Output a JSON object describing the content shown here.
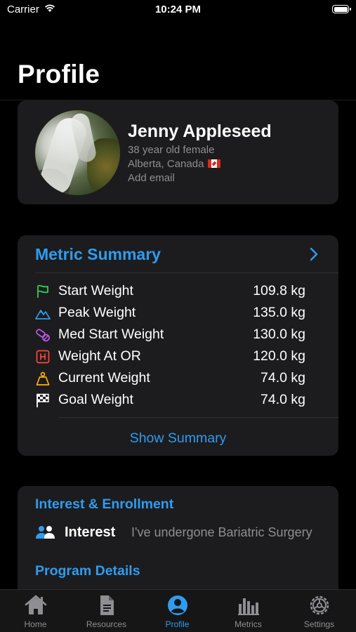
{
  "status": {
    "carrier": "Carrier",
    "time": "10:24 PM"
  },
  "page": {
    "title": "Profile"
  },
  "profile": {
    "name": "Jenny Appleseed",
    "age_gender": "38 year old female",
    "location": "Alberta, Canada",
    "email_placeholder": "Add email"
  },
  "metric_summary": {
    "title": "Metric Summary",
    "rows": [
      {
        "label": "Start Weight",
        "value": "109.8 kg",
        "icon": "flag-icon",
        "color": "#30d158"
      },
      {
        "label": "Peak Weight",
        "value": "135.0 kg",
        "icon": "mountain-icon",
        "color": "#2f9cf0"
      },
      {
        "label": "Med Start Weight",
        "value": "130.0 kg",
        "icon": "pills-icon",
        "color": "#bf5af2"
      },
      {
        "label": "Weight At OR",
        "value": "120.0 kg",
        "icon": "hospital-icon",
        "color": "#ff453a"
      },
      {
        "label": "Current Weight",
        "value": "74.0 kg",
        "icon": "scale-icon",
        "color": "#ffb300"
      },
      {
        "label": "Goal Weight",
        "value": "74.0 kg",
        "icon": "checkered-flag-icon",
        "color": "#ffffff"
      }
    ],
    "show_summary": "Show Summary"
  },
  "interest": {
    "title": "Interest & Enrollment",
    "label": "Interest",
    "value": "I've undergone Bariatric Surgery",
    "program_details": "Program Details"
  },
  "tabs": [
    {
      "label": "Home",
      "icon": "home-icon"
    },
    {
      "label": "Resources",
      "icon": "document-icon"
    },
    {
      "label": "Profile",
      "icon": "person-icon",
      "active": true
    },
    {
      "label": "Metrics",
      "icon": "bar-chart-icon"
    },
    {
      "label": "Settings",
      "icon": "gear-icon"
    }
  ],
  "colors": {
    "accent": "#2f9cf0",
    "background": "#000000",
    "card": "#1c1c1e",
    "secondary_text": "#8e8e93"
  }
}
